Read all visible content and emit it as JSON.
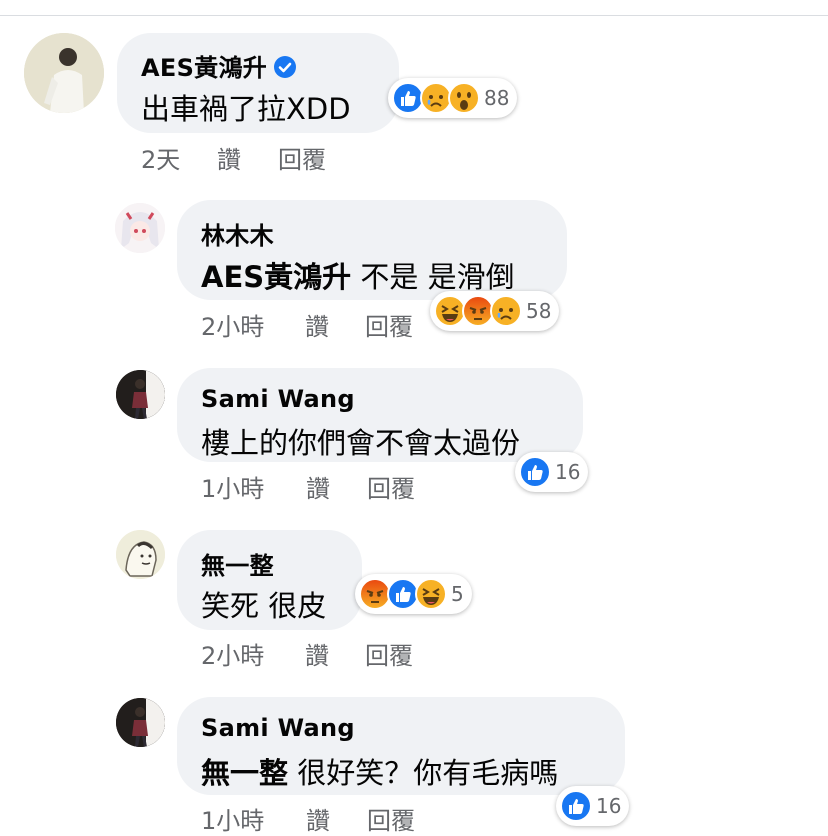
{
  "comments": [
    {
      "author": "AES黃鴻升",
      "verified": true,
      "text": "出車禍了拉XDD",
      "mention": "",
      "time": "2天",
      "like_label": "讚",
      "reply_label": "回覆",
      "reactions": [
        "like",
        "sad",
        "wow"
      ],
      "reaction_count": "88"
    },
    {
      "author": "林木木",
      "verified": false,
      "mention": "AES黃鴻升",
      "text": " 不是 是滑倒",
      "time": "2小時",
      "like_label": "讚",
      "reply_label": "回覆",
      "reactions": [
        "haha",
        "angry",
        "sad"
      ],
      "reaction_count": "58"
    },
    {
      "author": "Sami Wang",
      "verified": false,
      "mention": "",
      "text": "樓上的你們會不會太過份",
      "time": "1小時",
      "like_label": "讚",
      "reply_label": "回覆",
      "reactions": [
        "like"
      ],
      "reaction_count": "16"
    },
    {
      "author": "無一整",
      "verified": false,
      "mention": "",
      "text": "笑死 很皮",
      "time": "2小時",
      "like_label": "讚",
      "reply_label": "回覆",
      "reactions": [
        "angry",
        "like",
        "haha"
      ],
      "reaction_count": "5"
    },
    {
      "author": "Sami Wang",
      "verified": false,
      "mention": "無一整",
      "text": " 很好笑？你有毛病嗎",
      "time": "1小時",
      "like_label": "讚",
      "reply_label": "回覆",
      "reactions": [
        "like"
      ],
      "reaction_count": "16"
    }
  ],
  "colors": {
    "bubble": "#f0f2f5",
    "meta_text": "#65676b",
    "like_blue": "#1877f2",
    "emoji_yellow": "#f7b125",
    "angry_red": "#e9710f"
  }
}
